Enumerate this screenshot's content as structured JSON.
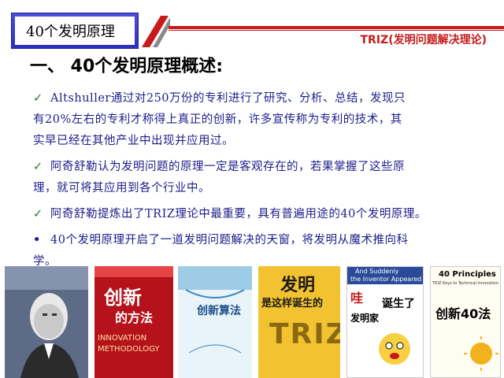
{
  "header": {
    "tab_title": "40个发明原理",
    "subject": "TRIZ(发明问题解决理论)"
  },
  "heading": "一、 40个发明原理概述:",
  "paragraphs": [
    {
      "icon": "check-icon",
      "lines": [
        "Altshuller通过对250万份的专利进行了研究、分析、总结，发现只",
        "有20%左右的专利才称得上真正的创新，许多宣传称为专利的技术，其",
        "实早已经在其他产业中出现并应用过。"
      ]
    },
    {
      "icon": "check-icon",
      "lines": [
        "阿奇舒勒认为发明问题的原理一定是客观存在的，若果掌握了这些原",
        "理，就可将其应用到各个行业中。"
      ]
    },
    {
      "icon": "check-icon",
      "lines": [
        "阿奇舒勒提炼出了TRIZ理论中最重要，具有普遍用途的40个发明原理。"
      ]
    },
    {
      "icon": "dot-icon",
      "lines": [
        "40个发明原理开启了一道发明问题解决的天窗，将发明从魔术推向科",
        "学。"
      ]
    }
  ],
  "books": [
    {
      "name": "book-portrait",
      "texts": []
    },
    {
      "name": "book-innovation-method",
      "texts": [
        "创新",
        "的方法",
        "INNOVATION",
        "METHODOLOGY"
      ]
    },
    {
      "name": "book-innovation-algorithm",
      "texts": [
        "创新算法"
      ]
    },
    {
      "name": "book-how-invention-born",
      "texts": [
        "发明",
        "是这样诞生的",
        "TRIZ"
      ]
    },
    {
      "name": "book-inventor-born",
      "texts": [
        "And Suddenly",
        "the Inventor Appeared",
        "哇",
        "发明家",
        "诞生了"
      ]
    },
    {
      "name": "book-40-principles",
      "texts": [
        "40 Principles",
        "TRIZ Keys to Technical Innovation",
        "创新40法"
      ]
    }
  ],
  "colors": {
    "accent_red": "#c71a1a",
    "tab_blue": "#2e2eb8",
    "text_blue": "#1d1d8a",
    "check_green": "#1a7a1a"
  }
}
